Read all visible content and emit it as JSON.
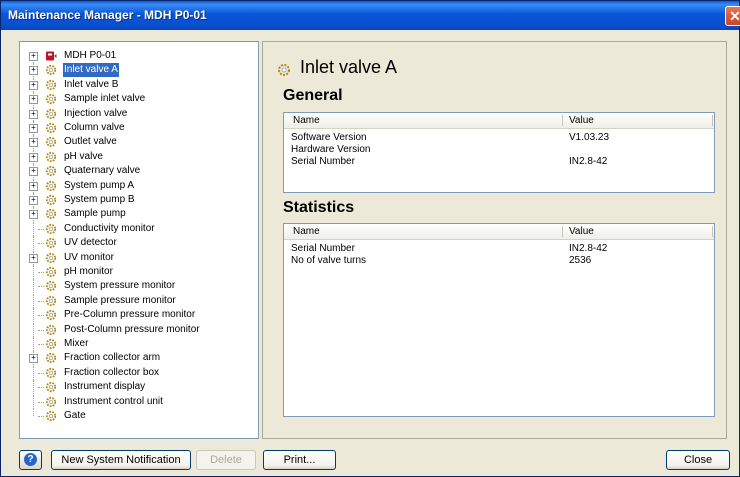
{
  "window": {
    "title": "Maintenance Manager - MDH P0-01",
    "close_glyph": "✕"
  },
  "tree": {
    "items": [
      {
        "label": "MDH P0-01",
        "expandable": true,
        "icon": "instrument-icon",
        "selected": false
      },
      {
        "label": "Inlet valve A",
        "expandable": true,
        "icon": "component-gear-icon",
        "selected": true
      },
      {
        "label": "Inlet valve B",
        "expandable": true,
        "icon": "component-gear-icon",
        "selected": false
      },
      {
        "label": "Sample inlet valve",
        "expandable": true,
        "icon": "component-gear-icon",
        "selected": false
      },
      {
        "label": "Injection valve",
        "expandable": true,
        "icon": "component-gear-icon",
        "selected": false
      },
      {
        "label": "Column valve",
        "expandable": true,
        "icon": "component-gear-icon",
        "selected": false
      },
      {
        "label": "Outlet valve",
        "expandable": true,
        "icon": "component-gear-icon",
        "selected": false
      },
      {
        "label": "pH valve",
        "expandable": true,
        "icon": "component-gear-icon",
        "selected": false
      },
      {
        "label": "Quaternary valve",
        "expandable": true,
        "icon": "component-gear-icon",
        "selected": false
      },
      {
        "label": "System pump A",
        "expandable": true,
        "icon": "component-gear-icon",
        "selected": false
      },
      {
        "label": "System pump B",
        "expandable": true,
        "icon": "component-gear-icon",
        "selected": false
      },
      {
        "label": "Sample pump",
        "expandable": true,
        "icon": "component-gear-icon",
        "selected": false
      },
      {
        "label": "Conductivity monitor",
        "expandable": false,
        "icon": "component-gear-icon",
        "selected": false
      },
      {
        "label": "UV detector",
        "expandable": false,
        "icon": "component-gear-icon",
        "selected": false
      },
      {
        "label": "UV monitor",
        "expandable": true,
        "icon": "component-gear-icon",
        "selected": false
      },
      {
        "label": "pH monitor",
        "expandable": false,
        "icon": "component-gear-icon",
        "selected": false
      },
      {
        "label": "System pressure monitor",
        "expandable": false,
        "icon": "component-gear-icon",
        "selected": false
      },
      {
        "label": "Sample pressure monitor",
        "expandable": false,
        "icon": "component-gear-icon",
        "selected": false
      },
      {
        "label": "Pre-Column pressure monitor",
        "expandable": false,
        "icon": "component-gear-icon",
        "selected": false
      },
      {
        "label": "Post-Column pressure monitor",
        "expandable": false,
        "icon": "component-gear-icon",
        "selected": false
      },
      {
        "label": "Mixer",
        "expandable": false,
        "icon": "component-gear-icon",
        "selected": false
      },
      {
        "label": "Fraction collector arm",
        "expandable": true,
        "icon": "component-gear-icon",
        "selected": false
      },
      {
        "label": "Fraction collector box",
        "expandable": false,
        "icon": "component-gear-icon",
        "selected": false
      },
      {
        "label": "Instrument display",
        "expandable": false,
        "icon": "component-gear-icon",
        "selected": false
      },
      {
        "label": "Instrument control unit",
        "expandable": false,
        "icon": "component-gear-icon",
        "selected": false
      },
      {
        "label": "Gate",
        "expandable": false,
        "icon": "component-gear-icon",
        "selected": false
      }
    ]
  },
  "detail": {
    "title": "Inlet valve A",
    "general": {
      "heading": "General",
      "columns": [
        "Name",
        "Value"
      ],
      "rows": [
        [
          "Software Version",
          "V1.03.23"
        ],
        [
          "Hardware Version",
          ""
        ],
        [
          "Serial Number",
          "IN2.8-42"
        ]
      ]
    },
    "statistics": {
      "heading": "Statistics",
      "columns": [
        "Name",
        "Value"
      ],
      "rows": [
        [
          "Serial Number",
          "IN2.8-42"
        ],
        [
          "No of valve turns",
          "2536"
        ]
      ]
    }
  },
  "buttons": {
    "help_glyph": "?",
    "new_notification": "New System Notification",
    "delete": "Delete",
    "print": "Print...",
    "close": "Close"
  }
}
